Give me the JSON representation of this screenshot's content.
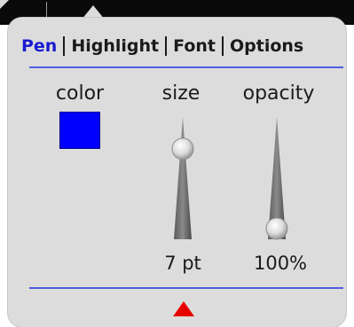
{
  "tabs": [
    {
      "label": "Pen",
      "active": true
    },
    {
      "label": "Highlight",
      "active": false
    },
    {
      "label": "Font",
      "active": false
    },
    {
      "label": "Options",
      "active": false
    }
  ],
  "pen": {
    "color_label": "color",
    "size_label": "size",
    "opacity_label": "opacity",
    "color_value": "#0000ff",
    "size_value": "7 pt",
    "opacity_value": "100%",
    "size_level": 0.75,
    "opacity_level": 0.0
  },
  "colors": {
    "accent": "#1a1ad0",
    "divider": "#4f5de0",
    "expand_arrow": "#e60000",
    "popup_background": "#dcdcdc"
  },
  "icons": {
    "expand": "red-triangle-up-icon"
  }
}
